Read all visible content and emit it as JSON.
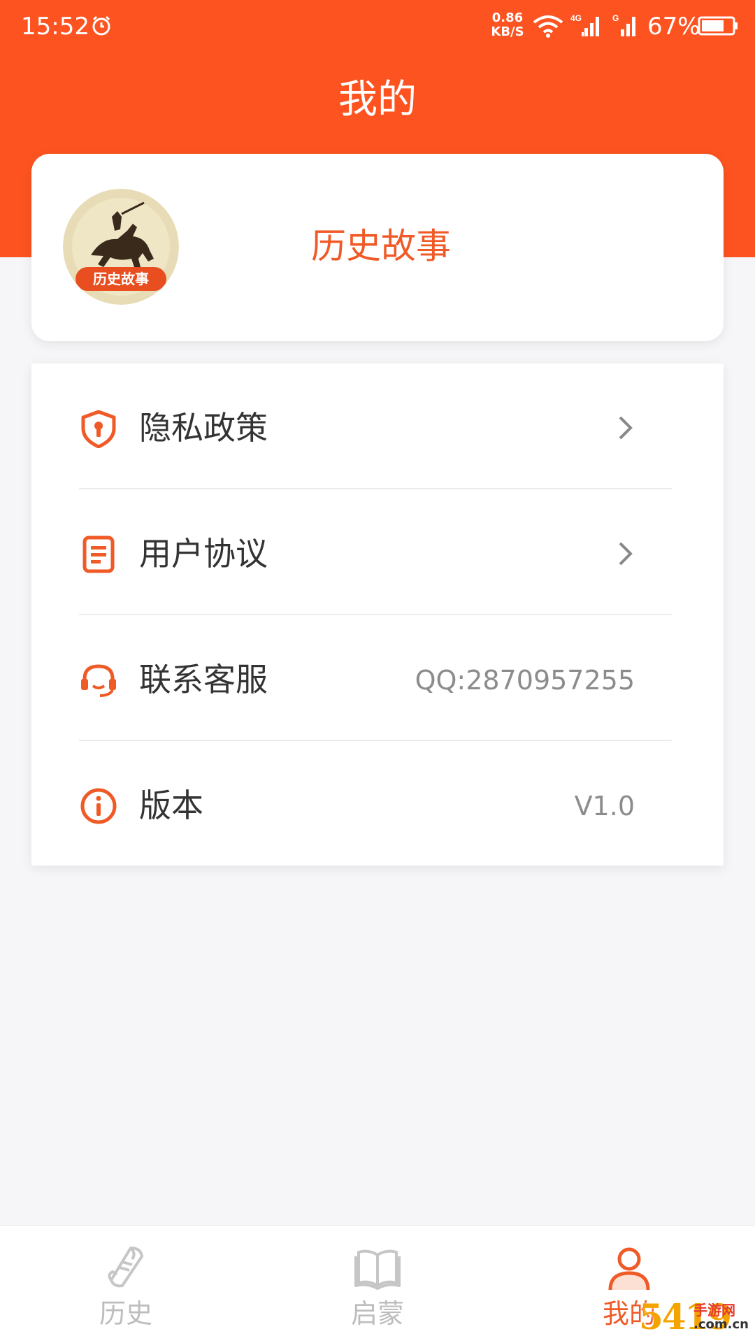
{
  "status_bar": {
    "time": "15:52",
    "net_speed_value": "0.86",
    "net_speed_unit": "KB/S",
    "network_1": "4G",
    "network_2": "G",
    "battery": "67%"
  },
  "header": {
    "title": "我的"
  },
  "profile": {
    "avatar_badge": "历史故事",
    "name": "历史故事"
  },
  "menu": [
    {
      "icon": "shield-icon",
      "label": "隐私政策",
      "value": "",
      "has_arrow": true
    },
    {
      "icon": "document-icon",
      "label": "用户协议",
      "value": "",
      "has_arrow": true
    },
    {
      "icon": "headset-icon",
      "label": "联系客服",
      "value": "QQ:2870957255",
      "has_arrow": false
    },
    {
      "icon": "info-icon",
      "label": "版本",
      "value": "V1.0",
      "has_arrow": false
    }
  ],
  "tabs": [
    {
      "icon": "scroll-icon",
      "label": "历史",
      "active": false
    },
    {
      "icon": "book-icon",
      "label": "启蒙",
      "active": false
    },
    {
      "icon": "person-icon",
      "label": "我的",
      "active": true
    }
  ],
  "watermark": {
    "number": "5419",
    "top": "手游网",
    "bottom": ".com.cn"
  },
  "colors": {
    "accent": "#fd5320",
    "accent_text": "#f05a27",
    "inactive_tab": "#bdbdbd"
  }
}
